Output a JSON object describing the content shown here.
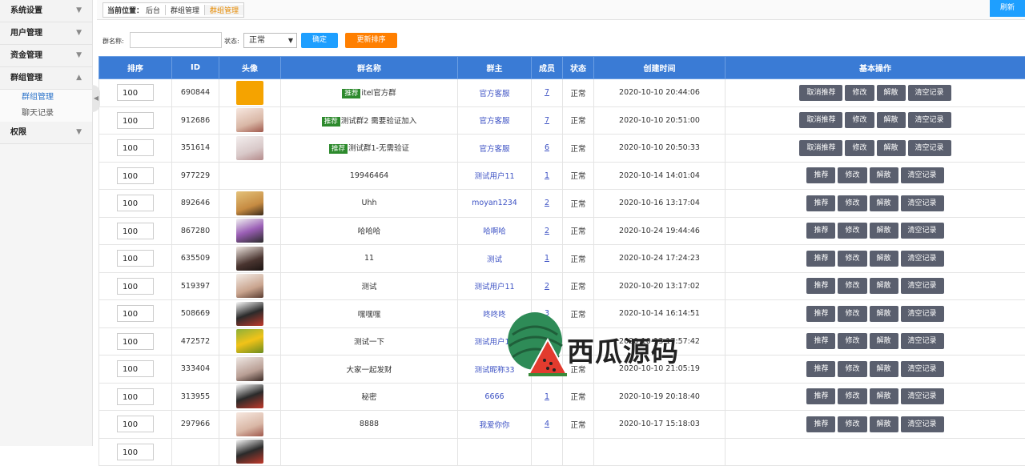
{
  "sidebar": {
    "sections": [
      {
        "label": "系统设置",
        "icon": "chevron-down-icon"
      },
      {
        "label": "用户管理",
        "icon": "chevron-down-icon"
      },
      {
        "label": "资金管理",
        "icon": "chevron-down-icon"
      },
      {
        "label": "群组管理",
        "icon": "chevron-up-icon"
      },
      {
        "label": "权限",
        "icon": "chevron-down-icon"
      }
    ],
    "subitems": [
      "群组管理",
      "聊天记录"
    ]
  },
  "topbar": {
    "breadcrumb_label": "当前位置：",
    "breadcrumb": [
      "后台",
      "群组管理",
      "群组管理"
    ],
    "refresh_label": "刷新"
  },
  "filters": {
    "name_label": "群名称:",
    "name_value": "",
    "status_label": "状态:",
    "status_value": "正常",
    "confirm_label": "确定",
    "sort_label": "更新排序"
  },
  "table": {
    "headers": [
      "排序",
      "ID",
      "头像",
      "群名称",
      "群主",
      "成员",
      "状态",
      "创建时间",
      "基本操作"
    ],
    "rec_tag": "推荐",
    "rows": [
      {
        "sort": "100",
        "id": "690844",
        "avatar": "itel",
        "recommended": true,
        "name": "itel官方群",
        "owner": "官方客服",
        "members": "7",
        "status": "正常",
        "created": "2020-10-10 20:44:06"
      },
      {
        "sort": "100",
        "id": "912686",
        "avatar": "girl1",
        "recommended": true,
        "name": "测试群2 需要验证加入",
        "owner": "官方客服",
        "members": "7",
        "status": "正常",
        "created": "2020-10-10 20:51:00"
      },
      {
        "sort": "100",
        "id": "351614",
        "avatar": "blur",
        "recommended": true,
        "name": "测试群1-无需验证",
        "owner": "官方客服",
        "members": "6",
        "status": "正常",
        "created": "2020-10-10 20:50:33"
      },
      {
        "sort": "100",
        "id": "977229",
        "avatar": "penguin",
        "recommended": false,
        "name": "19946464",
        "owner": "测试用户11",
        "members": "1",
        "status": "正常",
        "created": "2020-10-14 14:01:04"
      },
      {
        "sort": "100",
        "id": "892646",
        "avatar": "kid",
        "recommended": false,
        "name": "Uhh",
        "owner": "moyan1234",
        "members": "2",
        "status": "正常",
        "created": "2020-10-16 13:17:04"
      },
      {
        "sort": "100",
        "id": "867280",
        "avatar": "purple",
        "recommended": false,
        "name": "哈哈哈",
        "owner": "哈啊哈",
        "members": "2",
        "status": "正常",
        "created": "2020-10-24 19:44:46"
      },
      {
        "sort": "100",
        "id": "635509",
        "avatar": "girl2",
        "recommended": false,
        "name": "11",
        "owner": "测试",
        "members": "1",
        "status": "正常",
        "created": "2020-10-24 17:24:23"
      },
      {
        "sort": "100",
        "id": "519397",
        "avatar": "girl3",
        "recommended": false,
        "name": "测试",
        "owner": "测试用户11",
        "members": "2",
        "status": "正常",
        "created": "2020-10-20 13:17:02"
      },
      {
        "sort": "100",
        "id": "508669",
        "avatar": "hearts",
        "recommended": false,
        "name": "嘿嘿嘿",
        "owner": "咚咚咚",
        "members": "3",
        "status": "正常",
        "created": "2020-10-14 16:14:51"
      },
      {
        "sort": "100",
        "id": "472572",
        "avatar": "flowers",
        "recommended": false,
        "name": "测试一下",
        "owner": "测试用户11",
        "members": "",
        "status": "",
        "created": "2020-10-13 17:57:42"
      },
      {
        "sort": "100",
        "id": "333404",
        "avatar": "girl4",
        "recommended": false,
        "name": "大家一起发财",
        "owner": "测试昵称33",
        "members": "",
        "status": "正常",
        "created": "2020-10-10 21:05:19"
      },
      {
        "sort": "100",
        "id": "313955",
        "avatar": "hearts",
        "recommended": false,
        "name": "秘密",
        "owner": "6666",
        "members": "1",
        "status": "正常",
        "created": "2020-10-19 20:18:40"
      },
      {
        "sort": "100",
        "id": "297966",
        "avatar": "girl1",
        "recommended": false,
        "name": "8888",
        "owner": "我爱你你",
        "members": "4",
        "status": "正常",
        "created": "2020-10-17 15:18:03"
      },
      {
        "sort": "100",
        "id": "",
        "avatar": "hearts",
        "recommended": false,
        "name": "",
        "owner": "",
        "members": "",
        "status": "",
        "created": ""
      }
    ],
    "ops_recommended": [
      "取消推荐",
      "修改",
      "解散",
      "清空记录"
    ],
    "ops_normal": [
      "推荐",
      "修改",
      "解散",
      "清空记录"
    ]
  },
  "watermark": {
    "text": "西瓜源码"
  }
}
